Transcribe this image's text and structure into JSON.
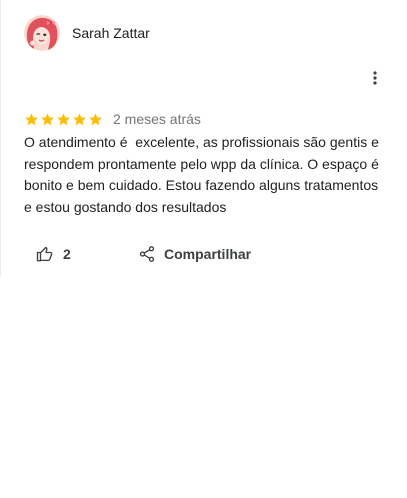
{
  "review": {
    "author": "Sarah Zattar",
    "rating": 5,
    "date": "2 meses atrás",
    "text": "O atendimento é  excelente, as profissionais são gentis e respondem prontamente pelo wpp da clínica. O espaço é bonito e bem cuidado. Estou fazendo alguns tratamentos e estou gostando dos resultados"
  },
  "actions": {
    "like_count": "2",
    "share_label": "Compartilhar"
  },
  "icons": {
    "more": "more-vertical-icon",
    "like": "thumbs-up-icon",
    "share": "share-icon",
    "star": "star-icon"
  },
  "colors": {
    "star": "#fbbc04",
    "text": "#202124",
    "muted": "#70757a",
    "icon": "#3c4043"
  }
}
